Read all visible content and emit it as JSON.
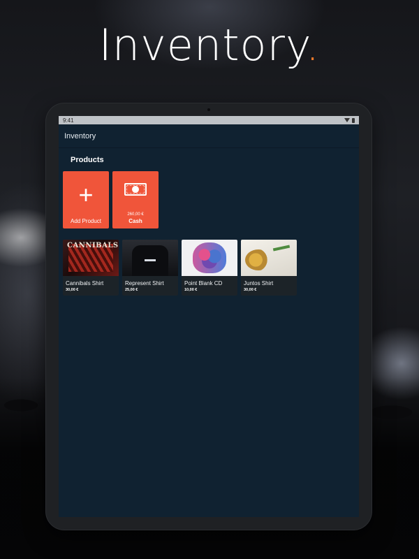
{
  "headline": {
    "text": "Inventory",
    "dot": "."
  },
  "status_bar": {
    "time": "9:41"
  },
  "app_bar": {
    "title": "Inventory"
  },
  "section": {
    "title": "Products"
  },
  "tiles": {
    "add_product": {
      "label": "Add Product",
      "icon": "plus-icon"
    },
    "cash": {
      "label": "Cash",
      "amount": "260,00 €",
      "icon": "cash-icon"
    }
  },
  "products": [
    {
      "name": "Cannibals Shirt",
      "price": "30,00 €",
      "art_text": "CANNIBALS"
    },
    {
      "name": "Represent Shirt",
      "price": "25,00 €"
    },
    {
      "name": "Point Blank CD",
      "price": "10,00 €"
    },
    {
      "name": "Juntos Shirt",
      "price": "30,00 €"
    }
  ],
  "colors": {
    "accent": "#f0553a",
    "screen_background": "#102231",
    "headline_dot": "#f07a2a"
  }
}
